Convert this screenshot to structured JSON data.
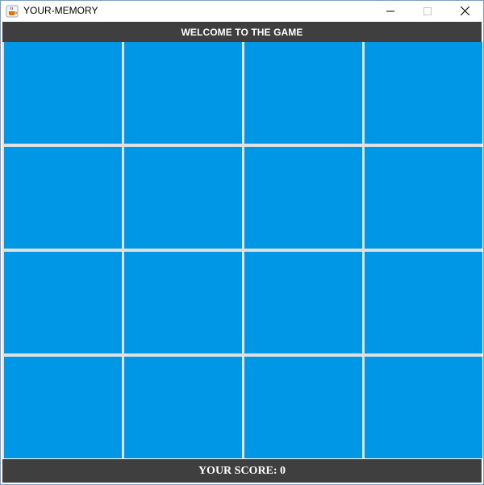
{
  "window": {
    "title": "YOUR-MEMORY",
    "icon": "java-cup-icon",
    "controls": {
      "minimize_icon": "minimize-icon",
      "maximize_icon": "maximize-icon",
      "close_icon": "close-icon"
    }
  },
  "header": {
    "welcome_text": "WELCOME TO THE GAME"
  },
  "board": {
    "rows": 4,
    "columns": 4,
    "tile_color": "#0098e6",
    "tiles_face_down": 16
  },
  "footer": {
    "score_label": "YOUR SCORE:",
    "score_value": 0,
    "score_text": "YOUR SCORE: 0"
  },
  "colors": {
    "bar_background": "#3f3f3f",
    "bar_text": "#ffffff",
    "grid_gap": "#e0e0e0"
  }
}
